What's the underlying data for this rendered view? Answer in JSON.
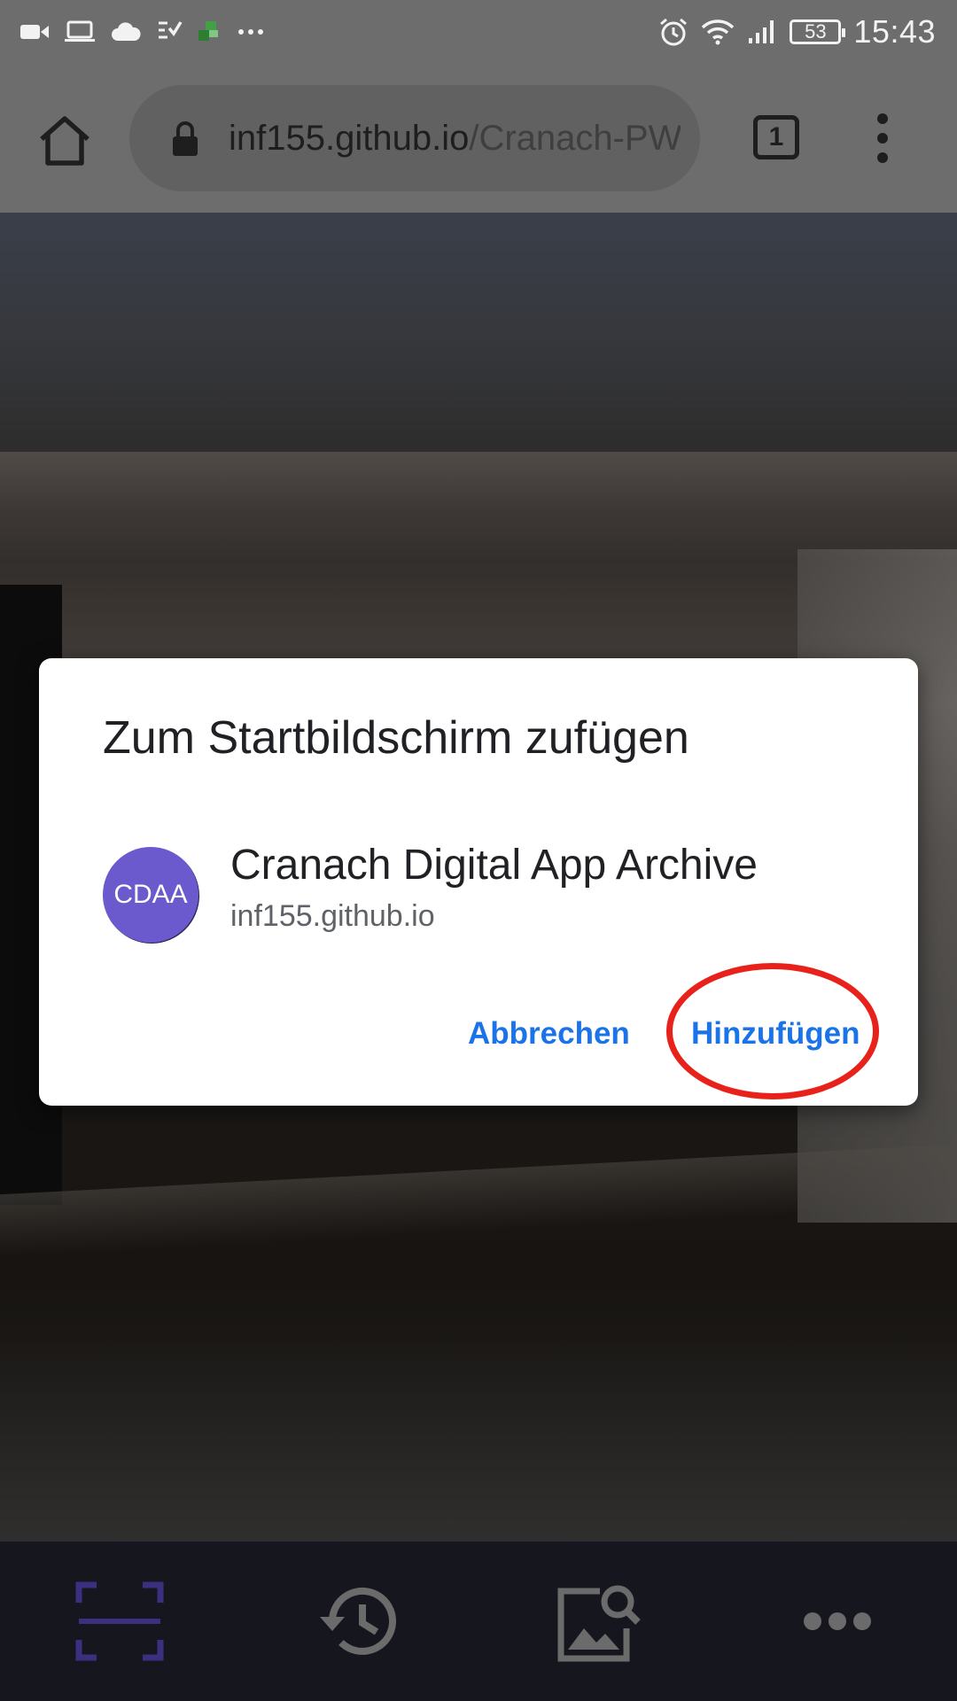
{
  "status_bar": {
    "time": "15:43",
    "battery": "53",
    "left_icons": [
      "video-icon",
      "laptop-icon",
      "cloud-icon",
      "checklist-icon",
      "app-notification-icon",
      "more-icon"
    ],
    "right_icons": [
      "alarm-icon",
      "wifi-icon",
      "signal-icon",
      "battery-icon"
    ]
  },
  "browser": {
    "url_host": "inf155.github.io",
    "url_path": "/Cranach-PWA",
    "tab_count": "1"
  },
  "dialog": {
    "title": "Zum Startbildschirm zufügen",
    "app_icon_text": "CDAA",
    "app_name": "Cranach Digital App Archive",
    "app_url": "inf155.github.io",
    "cancel_label": "Abbrechen",
    "add_label": "Hinzufügen"
  },
  "bottom_nav": {
    "items": [
      "scan-icon",
      "history-icon",
      "image-search-icon",
      "more-horizontal-icon"
    ]
  },
  "colors": {
    "accent": "#1a73e8",
    "highlight": "#e8221b",
    "app_icon": "#6a5acd",
    "scan_active": "#3b2f80"
  }
}
